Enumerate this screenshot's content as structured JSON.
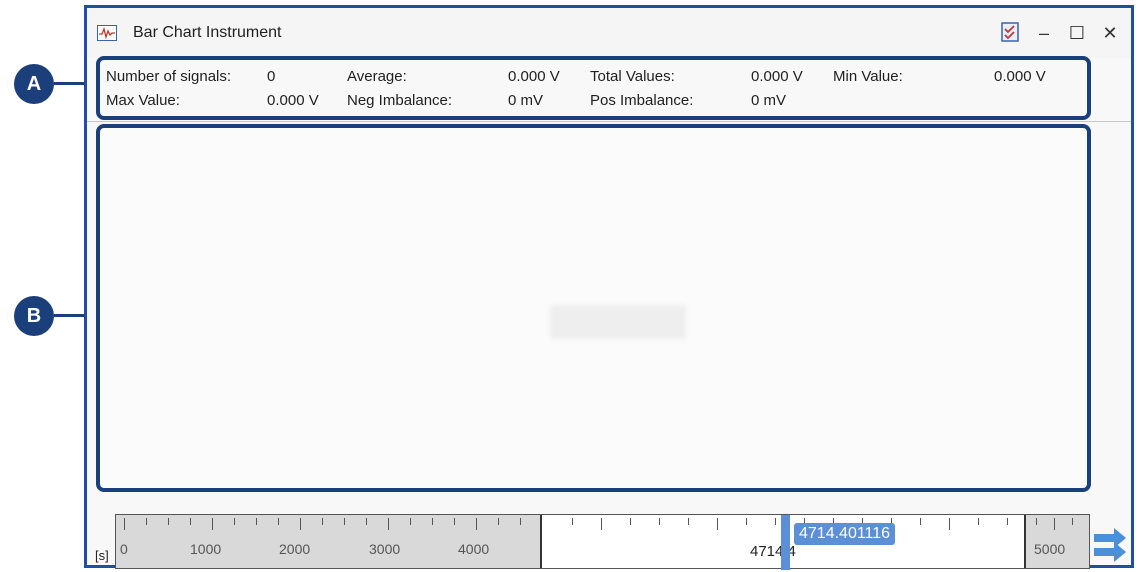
{
  "callouts": {
    "a": "A",
    "b": "B"
  },
  "window": {
    "title": "Bar Chart Instrument",
    "buttons": {
      "minimize": "–",
      "maximize": "☐",
      "close": "✕"
    }
  },
  "stats": {
    "row1": [
      {
        "label": "Number of signals:",
        "value": "0"
      },
      {
        "label": "Average:",
        "value": "0.000 V"
      },
      {
        "label": "Total Values:",
        "value": "0.000 V"
      },
      {
        "label": "Min Value:",
        "value": "0.000 V"
      }
    ],
    "row2": [
      {
        "label": "Max Value:",
        "value": "0.000 V"
      },
      {
        "label": "Neg Imbalance:",
        "value": "0 mV"
      },
      {
        "label": "Pos Imbalance:",
        "value": "0 mV"
      }
    ]
  },
  "timeline": {
    "unit": "[s]",
    "ticks": [
      "0",
      "1000",
      "2000",
      "3000",
      "4000",
      "5000"
    ],
    "cursor_value": "4714.401116",
    "cursor_axis_label": "4714.4"
  },
  "colors": {
    "accent": "#1b3f7a",
    "cursor": "#5b8fd6",
    "window_border": "#1e4fa3"
  }
}
